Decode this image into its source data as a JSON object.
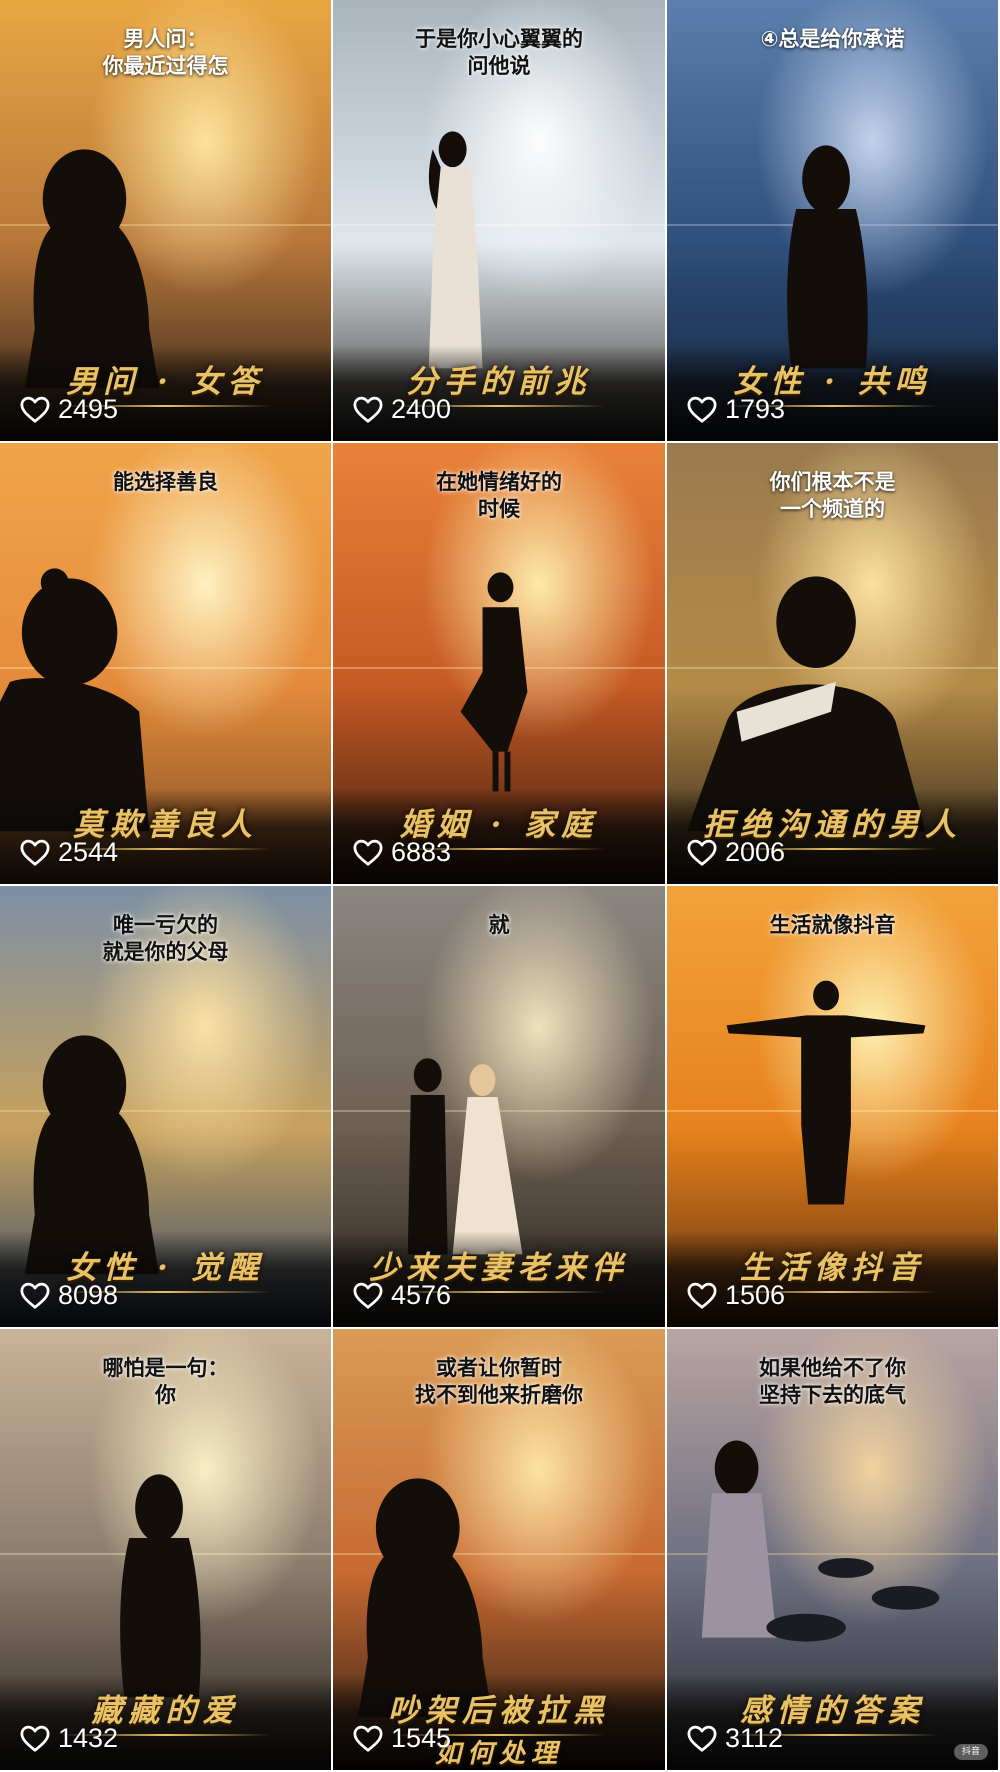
{
  "tiles": [
    {
      "headline": "男人问：\n你最近过得怎",
      "caption": "男问 · 女答",
      "likes": "2495",
      "palette": {
        "sky": "#e9a743",
        "mid": "#b8773a",
        "ground": "#2b2119",
        "sun": "#ffe7a0"
      },
      "dark_top": true,
      "figure": "woman-hair"
    },
    {
      "headline": "于是你小心翼翼的\n问他说",
      "caption": "分手的前兆",
      "likes": "2400",
      "palette": {
        "sky": "#a9b4bd",
        "mid": "#dfe6ec",
        "ground": "#3b3a36",
        "sun": "#ffffff"
      },
      "dark_top": false,
      "figure": "woman-standing"
    },
    {
      "headline": "④总是给你承诺",
      "caption": "女性 · 共鸣",
      "likes": "1793",
      "palette": {
        "sky": "#5d7fae",
        "mid": "#2f4f7c",
        "ground": "#142238",
        "sun": "#c9d8f0"
      },
      "dark_top": true,
      "figure": "woman-back"
    },
    {
      "headline": "能选择善良",
      "caption": "莫欺善良人",
      "likes": "2544",
      "palette": {
        "sky": "#f0a54a",
        "mid": "#e48b3b",
        "ground": "#7c4a22",
        "sun": "#fff6c8"
      },
      "dark_top": false,
      "figure": "woman-bun"
    },
    {
      "headline": "在她情绪好的\n时候",
      "caption": "婚姻 · 家庭",
      "likes": "6883",
      "palette": {
        "sky": "#e9823a",
        "mid": "#c65a24",
        "ground": "#3a1d10",
        "sun": "#fff1b0"
      },
      "dark_top": false,
      "figure": "woman-dress"
    },
    {
      "headline": "你们根本不是\n一个频道的",
      "caption": "拒绝沟通的男人",
      "likes": "2006",
      "palette": {
        "sky": "#9a7a4f",
        "mid": "#b48a46",
        "ground": "#2c2418",
        "sun": "#ffe5a3"
      },
      "dark_top": true,
      "figure": "woman-scarf"
    },
    {
      "headline": "唯一亏欠的\n就是你的父母",
      "caption": "女性 · 觉醒",
      "likes": "8098",
      "palette": {
        "sky": "#7d8fa4",
        "mid": "#c7a15d",
        "ground": "#324a6c",
        "sun": "#ffe4a6"
      },
      "dark_top": false,
      "figure": "woman-hair"
    },
    {
      "headline": "就",
      "caption": "少来夫妻老来伴",
      "likes": "4576",
      "palette": {
        "sky": "#8b8781",
        "mid": "#6c5f51",
        "ground": "#2a2520",
        "sun": "#f6e7c0"
      },
      "dark_top": false,
      "figure": "couple"
    },
    {
      "headline": "生活就像抖音",
      "caption": "生活像抖音",
      "likes": "1506",
      "palette": {
        "sky": "#f2a23c",
        "mid": "#e7821d",
        "ground": "#5b2f0e",
        "sun": "#fff4b6"
      },
      "dark_top": false,
      "figure": "man-arms"
    },
    {
      "headline": "哪怕是一句：\n你",
      "caption": "藏藏的爱",
      "likes": "1432",
      "palette": {
        "sky": "#c9b398",
        "mid": "#8a7a6b",
        "ground": "#2e2924",
        "sun": "#fff2c8"
      },
      "dark_top": false,
      "figure": "woman-back"
    },
    {
      "headline": "或者让你暂时\n找不到他来折磨你",
      "caption": "吵架后被拉黑",
      "likes": "1545",
      "palette": {
        "sky": "#d89b56",
        "mid": "#c86a32",
        "ground": "#2a1b12",
        "sun": "#ffe8a8"
      },
      "dark_top": false,
      "figure": "woman-hair"
    },
    {
      "headline": "如果他给不了你\n坚持下去的底气",
      "caption": "感情的答案",
      "likes": "3112",
      "palette": {
        "sky": "#b9a4a2",
        "mid": "#6c6f80",
        "ground": "#26272e",
        "sun": "#f6d6a0"
      },
      "dark_top": false,
      "figure": "woman-rocks"
    }
  ],
  "extra_subtitle_tile_11": "如何处理",
  "icons": {
    "like": "heart-outline-icon"
  },
  "watermark": "抖音"
}
